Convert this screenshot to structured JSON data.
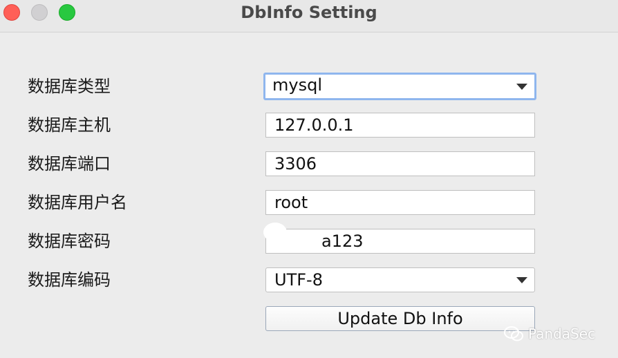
{
  "window": {
    "title": "DbInfo Setting"
  },
  "form": {
    "db_type": {
      "label": "数据库类型",
      "value": "mysql"
    },
    "db_host": {
      "label": "数据库主机",
      "value": "127.0.0.1"
    },
    "db_port": {
      "label": "数据库端口",
      "value": "3306"
    },
    "db_user": {
      "label": "数据库用户名",
      "value": "root"
    },
    "db_password": {
      "label": "数据库密码",
      "value": "a123"
    },
    "db_encoding": {
      "label": "数据库编码",
      "value": "UTF-8"
    }
  },
  "actions": {
    "update_label": "Update Db Info"
  },
  "watermark": {
    "text": "PandaSec",
    "icon": "wechat-icon"
  },
  "colors": {
    "close": "#ff5f57",
    "minimize": "#d1d0d2",
    "zoom": "#28c840",
    "focus_ring": "#8fb6ee"
  }
}
